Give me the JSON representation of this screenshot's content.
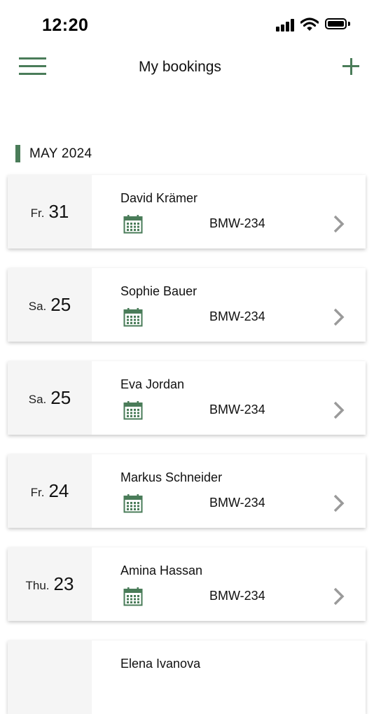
{
  "status_bar": {
    "time": "12:20"
  },
  "header": {
    "title": "My bookings",
    "menu_icon": "hamburger-menu-icon",
    "add_icon": "plus-icon",
    "accent_color": "#4a7c59"
  },
  "section": {
    "title": "MAY 2024"
  },
  "bookings": [
    {
      "weekday": "Fr.",
      "day": "31",
      "name": "David Krämer",
      "plate": "BMW-234"
    },
    {
      "weekday": "Sa.",
      "day": "25",
      "name": "Sophie Bauer",
      "plate": "BMW-234"
    },
    {
      "weekday": "Sa.",
      "day": "25",
      "name": "Eva Jordan",
      "plate": "BMW-234"
    },
    {
      "weekday": "Fr.",
      "day": "24",
      "name": "Markus Schneider",
      "plate": "BMW-234"
    },
    {
      "weekday": "Thu.",
      "day": "23",
      "name": "Amina Hassan",
      "plate": "BMW-234"
    },
    {
      "weekday": "",
      "day": "",
      "name": "Elena Ivanova",
      "plate": ""
    }
  ]
}
